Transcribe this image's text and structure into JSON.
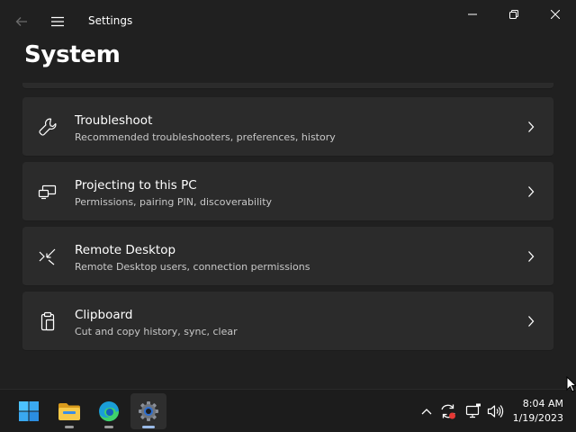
{
  "window": {
    "title": "Settings",
    "page_title": "System"
  },
  "cards": [
    {
      "icon": "wrench-icon",
      "title": "Troubleshoot",
      "subtitle": "Recommended troubleshooters, preferences, history"
    },
    {
      "icon": "projector-icon",
      "title": "Projecting to this PC",
      "subtitle": "Permissions, pairing PIN, discoverability"
    },
    {
      "icon": "remote-desktop-icon",
      "title": "Remote Desktop",
      "subtitle": "Remote Desktop users, connection permissions"
    },
    {
      "icon": "clipboard-icon",
      "title": "Clipboard",
      "subtitle": "Cut and copy history, sync, clear"
    }
  ],
  "taskbar": {
    "apps": [
      {
        "name": "start-icon"
      },
      {
        "name": "file-explorer-icon"
      },
      {
        "name": "edge-icon"
      },
      {
        "name": "settings-icon",
        "active": true
      }
    ],
    "clock": {
      "time": "8:04 AM",
      "date": "1/19/2023"
    }
  },
  "colors": {
    "background": "#202020",
    "card": "#2b2b2b",
    "taskbar": "#1c1c1c",
    "subtitle": "#c8c8c8"
  }
}
